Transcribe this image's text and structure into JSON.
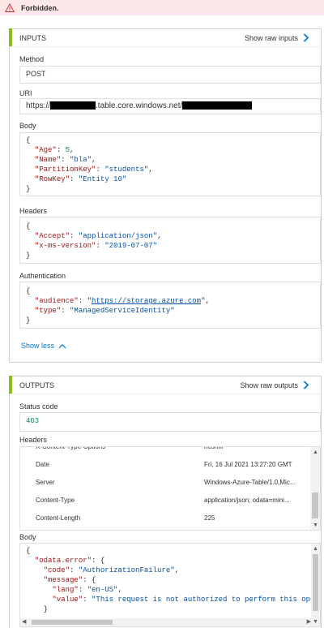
{
  "banner": {
    "message": "Forbidden.",
    "icon": "warning-icon",
    "bg": "#fde7e9",
    "icon_color": "#d13438"
  },
  "inputs": {
    "title": "INPUTS",
    "show_raw": "Show raw inputs",
    "method_label": "Method",
    "method_value": "POST",
    "uri_label": "URI",
    "uri_prefix": "https://",
    "uri_middle": ".table.core.windows.net/",
    "body_label": "Body",
    "body": {
      "open": "{",
      "age_key": "\"Age\"",
      "age_val": "5",
      "name_key": "\"Name\"",
      "name_val": "\"bla\"",
      "pk_key": "\"PartitionKey\"",
      "pk_val": "\"students\"",
      "rk_key": "\"RowKey\"",
      "rk_val": "\"Entity 10\"",
      "close": "}"
    },
    "headers_label": "Headers",
    "headers": {
      "open": "{",
      "accept_key": "\"Accept\"",
      "accept_val": "\"application/json\"",
      "ver_key": "\"x-ms-version\"",
      "ver_val": "\"2019-07-07\"",
      "close": "}"
    },
    "auth_label": "Authentication",
    "auth": {
      "open": "{",
      "aud_key": "\"audience\"",
      "aud_q1": "\"",
      "aud_url": "https://storage.azure.com",
      "aud_q2": "\"",
      "type_key": "\"type\"",
      "type_val": "\"ManagedServiceIdentity\"",
      "close": "}"
    },
    "show_less": "Show less"
  },
  "outputs": {
    "title": "OUTPUTS",
    "show_raw": "Show raw outputs",
    "status_label": "Status code",
    "status_value": "403",
    "headers_label": "Headers",
    "header_rows": [
      {
        "key": "X-Content-Type-Options",
        "value": "nosniff"
      },
      {
        "key": "Date",
        "value": "Fri, 16 Jul 2021 13:27:20 GMT"
      },
      {
        "key": "Server",
        "value": "Windows-Azure-Table/1.0,Mic..."
      },
      {
        "key": "Content-Type",
        "value": "application/json; odata=mini..."
      },
      {
        "key": "Content-Length",
        "value": "225"
      }
    ],
    "body_label": "Body",
    "body": {
      "open": "{",
      "err_key": "\"odata.error\"",
      "brace": "{",
      "code_key": "\"code\"",
      "code_val": "\"AuthorizationFailure\"",
      "msg_key": "\"message\"",
      "lang_key": "\"lang\"",
      "lang_val": "\"en-US\"",
      "value_key": "\"value\"",
      "value_val": "\"This request is not authorized to perform this oper",
      "close_inner": "}"
    }
  }
}
